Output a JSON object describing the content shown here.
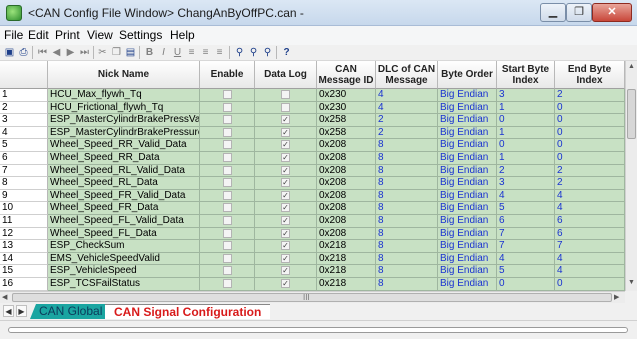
{
  "window": {
    "title": "<CAN Config File Window> ChangAnByOffPC.can -",
    "min_glyph": "▁",
    "max_glyph": "❐",
    "close_glyph": "✕"
  },
  "menu": [
    "File",
    "Edit",
    "Print",
    "View",
    "Settings",
    "Help"
  ],
  "toolbar": {
    "icons": [
      "save-icon",
      "print-icon",
      "first-icon",
      "prev-icon",
      "next-icon",
      "last-icon",
      "cut-icon",
      "copy-icon",
      "paste-icon",
      "bold-icon",
      "italic-icon",
      "underline-icon",
      "align-left-icon",
      "align-center-icon",
      "align-right-icon",
      "find-icon",
      "find-next-icon",
      "find-prev-icon",
      "help-icon"
    ]
  },
  "grid": {
    "columns": [
      "",
      "Nick Name",
      "Enable",
      "Data Log",
      "CAN Message ID",
      "DLC of CAN Message",
      "Byte Order",
      "Start Byte Index",
      "End Byte Index"
    ],
    "rows": [
      {
        "n": "1",
        "name": "HCU_Max_flywh_Tq",
        "enable": false,
        "log": false,
        "id": "0x230",
        "dlc": "4",
        "order": "Big Endian",
        "start": "3",
        "end": "2"
      },
      {
        "n": "2",
        "name": "HCU_Frictional_flywh_Tq",
        "enable": false,
        "log": false,
        "id": "0x230",
        "dlc": "4",
        "order": "Big Endian",
        "start": "1",
        "end": "0"
      },
      {
        "n": "3",
        "name": "ESP_MasterCylindrBrakePressValid",
        "enable": false,
        "log": true,
        "id": "0x258",
        "dlc": "2",
        "order": "Big Endian",
        "start": "0",
        "end": "0"
      },
      {
        "n": "4",
        "name": "ESP_MasterCylindrBrakePressure",
        "enable": false,
        "log": true,
        "id": "0x258",
        "dlc": "2",
        "order": "Big Endian",
        "start": "1",
        "end": "0"
      },
      {
        "n": "5",
        "name": "Wheel_Speed_RR_Valid_Data",
        "enable": false,
        "log": true,
        "id": "0x208",
        "dlc": "8",
        "order": "Big Endian",
        "start": "0",
        "end": "0"
      },
      {
        "n": "6",
        "name": "Wheel_Speed_RR_Data",
        "enable": false,
        "log": true,
        "id": "0x208",
        "dlc": "8",
        "order": "Big Endian",
        "start": "1",
        "end": "0"
      },
      {
        "n": "7",
        "name": "Wheel_Speed_RL_Valid_Data",
        "enable": false,
        "log": true,
        "id": "0x208",
        "dlc": "8",
        "order": "Big Endian",
        "start": "2",
        "end": "2"
      },
      {
        "n": "8",
        "name": "Wheel_Speed_RL_Data",
        "enable": false,
        "log": true,
        "id": "0x208",
        "dlc": "8",
        "order": "Big Endian",
        "start": "3",
        "end": "2"
      },
      {
        "n": "9",
        "name": "Wheel_Speed_FR_Valid_Data",
        "enable": false,
        "log": true,
        "id": "0x208",
        "dlc": "8",
        "order": "Big Endian",
        "start": "4",
        "end": "4"
      },
      {
        "n": "10",
        "name": "Wheel_Speed_FR_Data",
        "enable": false,
        "log": true,
        "id": "0x208",
        "dlc": "8",
        "order": "Big Endian",
        "start": "5",
        "end": "4"
      },
      {
        "n": "11",
        "name": "Wheel_Speed_FL_Valid_Data",
        "enable": false,
        "log": true,
        "id": "0x208",
        "dlc": "8",
        "order": "Big Endian",
        "start": "6",
        "end": "6"
      },
      {
        "n": "12",
        "name": "Wheel_Speed_FL_Data",
        "enable": false,
        "log": true,
        "id": "0x208",
        "dlc": "8",
        "order": "Big Endian",
        "start": "7",
        "end": "6"
      },
      {
        "n": "13",
        "name": "ESP_CheckSum",
        "enable": false,
        "log": true,
        "id": "0x218",
        "dlc": "8",
        "order": "Big Endian",
        "start": "7",
        "end": "7"
      },
      {
        "n": "14",
        "name": "EMS_VehicleSpeedValid",
        "enable": false,
        "log": true,
        "id": "0x218",
        "dlc": "8",
        "order": "Big Endian",
        "start": "4",
        "end": "4"
      },
      {
        "n": "15",
        "name": "ESP_VehicleSpeed",
        "enable": false,
        "log": true,
        "id": "0x218",
        "dlc": "8",
        "order": "Big Endian",
        "start": "5",
        "end": "4"
      },
      {
        "n": "16",
        "name": "ESP_TCSFailStatus",
        "enable": false,
        "log": true,
        "id": "0x218",
        "dlc": "8",
        "order": "Big Endian",
        "start": "0",
        "end": "0"
      }
    ]
  },
  "scroll": {
    "hscroll_grip": "III"
  },
  "tabs": {
    "global": "CAN Global",
    "signal": "CAN Signal Configuration",
    "nav_prev": "◀",
    "nav_next": "▶"
  },
  "colors": {
    "row_bg": "#c8e1c4",
    "number_text": "#1a33d1",
    "active_tab_text": "#d81a1a",
    "inactive_tab_bg": "#1aa5a1"
  }
}
